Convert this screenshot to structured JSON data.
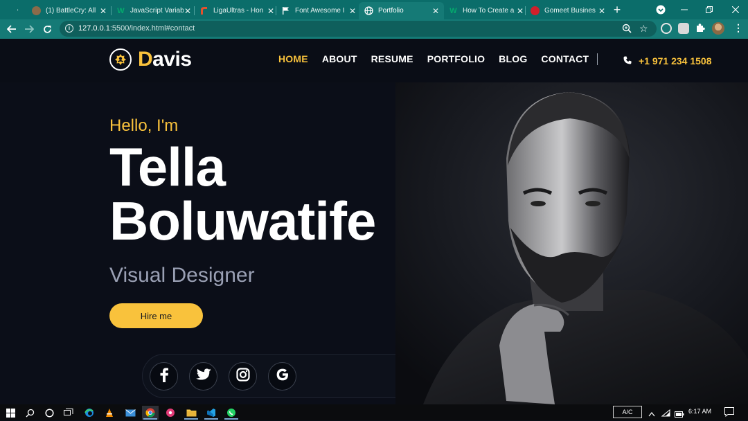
{
  "browser": {
    "tabs": [
      {
        "title": "(1) BattleCry: All",
        "favicon": "battlecry-avatar",
        "color": "#8b6b4a",
        "active": false
      },
      {
        "title": "JavaScript Variab",
        "favicon": "w3-icon",
        "color": "#04aa6d",
        "active": false
      },
      {
        "title": "LigaUltras - Hon",
        "favicon": "ligaultras-icon",
        "color": "#e2512d",
        "active": false
      },
      {
        "title": "Font Awesome I",
        "favicon": "flag-icon",
        "color": "#1d1d1d",
        "active": false
      },
      {
        "title": "Portfolio",
        "favicon": "globe-icon",
        "color": "#157a76",
        "active": true
      },
      {
        "title": "How To Create a",
        "favicon": "w3-icon",
        "color": "#04aa6d",
        "active": false
      },
      {
        "title": "Gomeet Busines",
        "favicon": "gomeet-icon",
        "color": "#d0202b",
        "active": false
      }
    ],
    "leading_tab_marker": ".",
    "url_host": "127.0.0.1",
    "url_rest": ":5500/index.html#contact"
  },
  "site": {
    "logo_first": "D",
    "logo_rest": "avis",
    "nav": [
      "HOME",
      "ABOUT",
      "RESUME",
      "PORTFOLIO",
      "BLOG",
      "CONTACT"
    ],
    "nav_active": "HOME",
    "phone": "+1 971 234 1508",
    "greeting": "Hello, I'm",
    "name_line1": "Tella",
    "name_line2": "Boluwatife",
    "role": "Visual Designer",
    "cta": "Hire me",
    "socials": [
      "facebook-icon",
      "twitter-icon",
      "instagram-icon",
      "google-icon"
    ]
  },
  "taskbar": {
    "ac_label": "A/C",
    "time": "6:17 AM"
  },
  "colors": {
    "accent": "#f9c23c",
    "chrome": "#157a76",
    "background": "#0b0e18"
  }
}
